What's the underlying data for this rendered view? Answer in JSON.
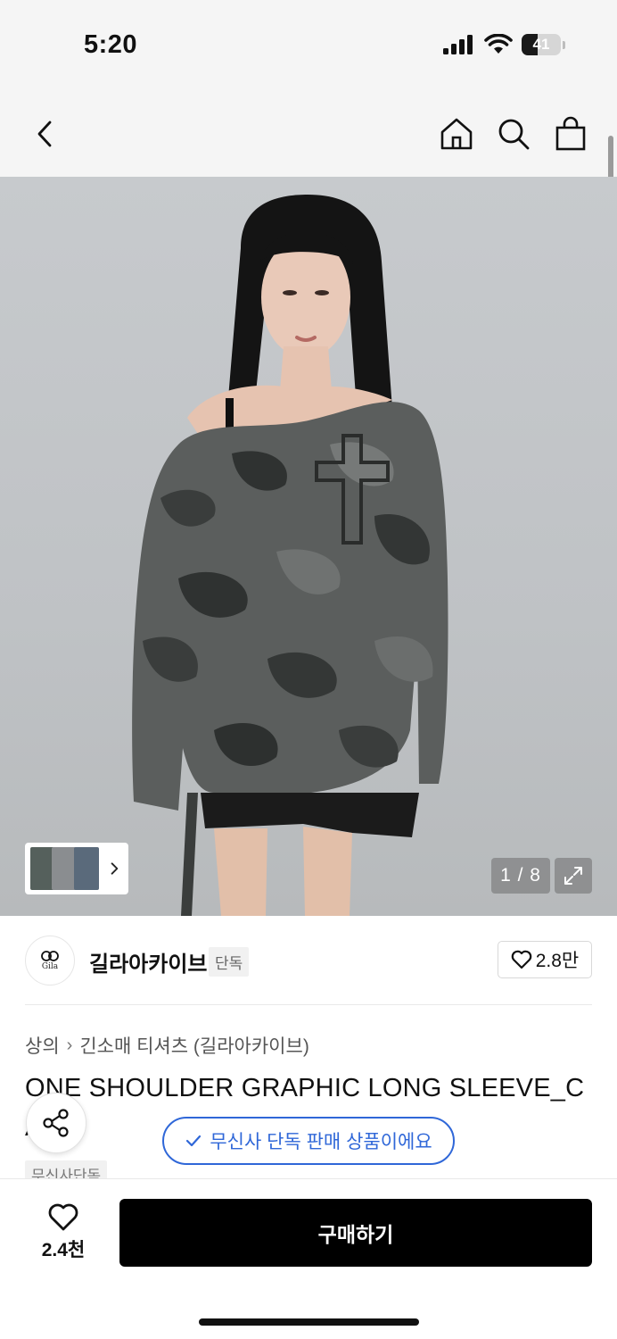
{
  "status_bar": {
    "time": "5:20",
    "battery": "41",
    "battery_level": 0.41
  },
  "hero": {
    "counter": "1 / 8"
  },
  "brand": {
    "logo_text": "Gila",
    "name": "길라아카이브",
    "badge": "단독",
    "likes": "2.8만"
  },
  "breadcrumb": {
    "level1": "상의",
    "separator": "›",
    "level2": "긴소매 티셔츠 (길라아카이브)"
  },
  "product": {
    "title_line1": "ONE SHOULDER GRAPHIC LONG SLEEVE_C",
    "title_line2": "A",
    "tag": "무신사단독"
  },
  "exclusive_notice": "무신사 단독 판매 상품이에요",
  "bottom": {
    "like_count": "2.4천",
    "buy_label": "구매하기"
  },
  "colors": {
    "accent_blue": "#2f67d8",
    "buy_button": "#000000"
  }
}
